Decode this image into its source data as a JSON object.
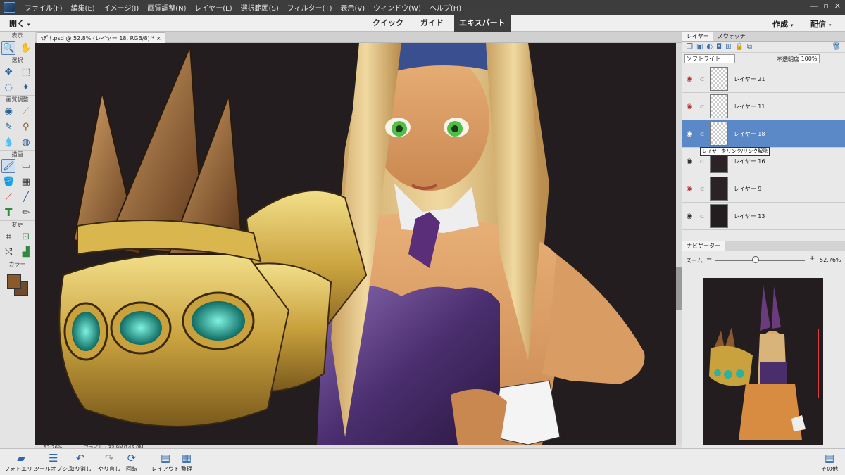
{
  "menu": [
    "ファイル(F)",
    "編集(E)",
    "イメージ(I)",
    "画質調整(N)",
    "レイヤー(L)",
    "選択範囲(S)",
    "フィルター(T)",
    "表示(V)",
    "ウィンドウ(W)",
    "ヘルプ(H)"
  ],
  "window_controls": [
    "—",
    "▫",
    "✕"
  ],
  "modebar": {
    "open_label": "開く",
    "modes": [
      "クイック",
      "ガイド",
      "エキスパート"
    ],
    "create_label": "作成",
    "share_label": "配信"
  },
  "tool_sections": [
    "表示",
    "選択",
    "画質調整",
    "描画",
    "変更",
    "カラー"
  ],
  "document": {
    "tab_title": "ｾﾃﾞｻ.psd @ 52.8% (レイヤー 18, RGB/8) *",
    "close_icon": "×"
  },
  "status": {
    "zoom": "52.76%",
    "file_info": "ファイル : 33.9M/145.0M"
  },
  "layers_panel": {
    "tabs": [
      "レイヤー",
      "スウォッチ"
    ],
    "blend_mode": "ソフトライト",
    "opacity_label": "不透明度 :",
    "opacity_value": "100%",
    "layers": [
      {
        "name": "レイヤー 21",
        "visible": false,
        "thumb": "transparent"
      },
      {
        "name": "レイヤー 11",
        "visible": false,
        "thumb": "transparent"
      },
      {
        "name": "レイヤー 18",
        "visible": true,
        "thumb": "transparent",
        "selected": true
      },
      {
        "name": "レイヤー 16",
        "visible": true,
        "thumb": "figure"
      },
      {
        "name": "レイヤー 9",
        "visible": false,
        "thumb": "figure"
      },
      {
        "name": "レイヤー 13",
        "visible": true,
        "thumb": "dark"
      }
    ],
    "tooltip": "レイヤーをリンク/リンク解除"
  },
  "navigator": {
    "tab": "ナビゲーター",
    "zoom_label": "ズーム :",
    "zoom_value": "52.76%"
  },
  "bottombar": {
    "left": [
      "フォトエリア",
      "ツールオプシ...",
      "取り消し",
      "やり直し",
      "回転",
      "レイアウト",
      "整理"
    ],
    "right": "その他"
  },
  "colors": {
    "foreground": "#8b5a2b",
    "background": "#6e4a2f",
    "selected_layer": "#5b89c8"
  }
}
